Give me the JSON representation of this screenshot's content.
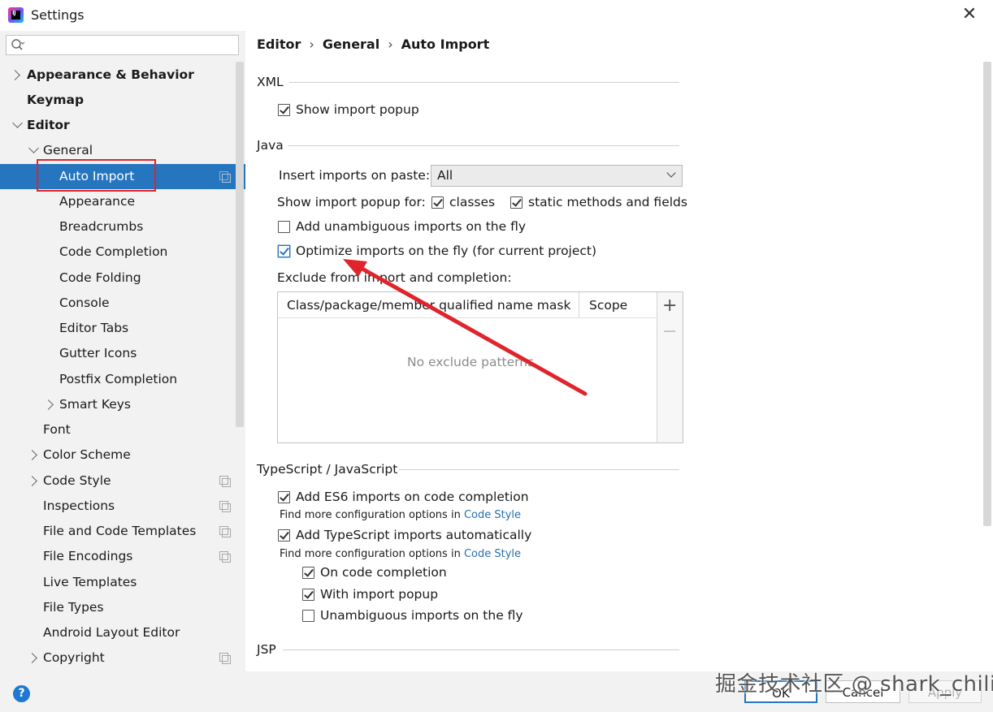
{
  "window": {
    "title": "Settings",
    "app_icon_text": "IJ"
  },
  "search": {
    "placeholder": ""
  },
  "tree": {
    "items": [
      {
        "label": "Appearance & Behavior"
      },
      {
        "label": "Keymap"
      },
      {
        "label": "Editor"
      },
      {
        "label": "General"
      },
      {
        "label": "Auto Import"
      },
      {
        "label": "Appearance"
      },
      {
        "label": "Breadcrumbs"
      },
      {
        "label": "Code Completion"
      },
      {
        "label": "Code Folding"
      },
      {
        "label": "Console"
      },
      {
        "label": "Editor Tabs"
      },
      {
        "label": "Gutter Icons"
      },
      {
        "label": "Postfix Completion"
      },
      {
        "label": "Smart Keys"
      },
      {
        "label": "Font"
      },
      {
        "label": "Color Scheme"
      },
      {
        "label": "Code Style"
      },
      {
        "label": "Inspections"
      },
      {
        "label": "File and Code Templates"
      },
      {
        "label": "File Encodings"
      },
      {
        "label": "Live Templates"
      },
      {
        "label": "File Types"
      },
      {
        "label": "Android Layout Editor"
      },
      {
        "label": "Copyright"
      }
    ],
    "selected": "Auto Import"
  },
  "breadcrumb": {
    "items": [
      "Editor",
      "General",
      "Auto Import"
    ],
    "separator": "›"
  },
  "xml": {
    "section_title": "XML",
    "show_import_popup": {
      "label": "Show import popup",
      "checked": true
    }
  },
  "java": {
    "section_title": "Java",
    "insert_imports_label": "Insert imports on paste:",
    "insert_imports_value": "All",
    "show_popup_for_label": "Show import popup for:",
    "classes": {
      "label": "classes",
      "checked": true
    },
    "static_methods": {
      "label": "static methods and fields",
      "checked": true
    },
    "add_unambiguous": {
      "label": "Add unambiguous imports on the fly",
      "checked": false
    },
    "optimize_imports": {
      "label": "Optimize imports on the fly (for current project)",
      "checked": true
    },
    "exclude_label": "Exclude from import and completion:",
    "table": {
      "columns": [
        "Class/package/member qualified name mask",
        "Scope"
      ],
      "empty_text": "No exclude patterns",
      "add": "+",
      "remove": "−"
    }
  },
  "ts": {
    "section_title": "TypeScript / JavaScript",
    "es6": {
      "label": "Add ES6 imports on code completion",
      "checked": true
    },
    "hint1_prefix": "Find more configuration options in ",
    "hint1_link": "Code Style",
    "ts_auto": {
      "label": "Add TypeScript imports automatically",
      "checked": true
    },
    "hint2_prefix": "Find more configuration options in ",
    "hint2_link": "Code Style",
    "on_completion": {
      "label": "On code completion",
      "checked": true
    },
    "with_popup": {
      "label": "With import popup",
      "checked": true
    },
    "unambiguous": {
      "label": "Unambiguous imports on the fly",
      "checked": false
    }
  },
  "jsp": {
    "section_title": "JSP"
  },
  "footer": {
    "help": "?",
    "ok": "OK",
    "cancel": "Cancel",
    "apply": "Apply"
  },
  "watermark": "掘金技术社区 @ shark_chili",
  "colors": {
    "selection": "#2675bf",
    "highlight_box": "#e0242c",
    "arrow": "#e0242c",
    "link": "#2470b3"
  }
}
